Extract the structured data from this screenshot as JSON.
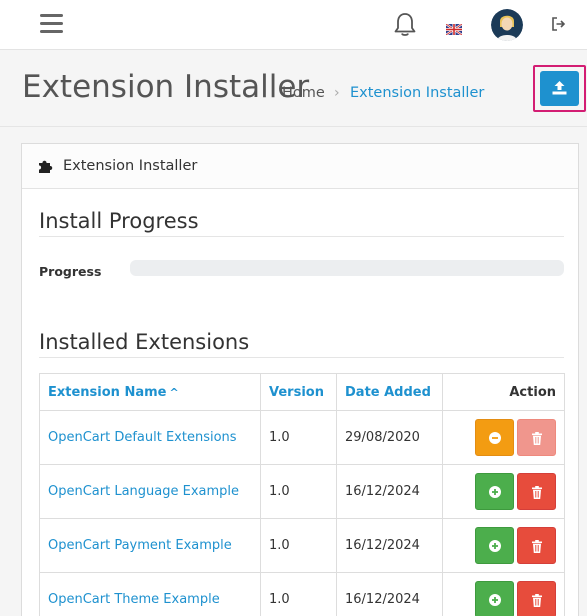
{
  "header": {
    "menu_icon": "hamburger-menu-icon",
    "notification_icon": "bell-icon",
    "language_icon": "uk-flag-icon",
    "user_icon": "user-avatar",
    "logout_icon": "sign-out-icon"
  },
  "page": {
    "title": "Extension Installer",
    "breadcrumb": [
      {
        "label": "Home"
      },
      {
        "label": "Extension Installer"
      }
    ],
    "breadcrumb_separator": "›",
    "upload_icon": "upload-icon"
  },
  "panel": {
    "heading": "Extension Installer",
    "heading_icon": "puzzle-piece-icon"
  },
  "install_progress": {
    "title": "Install Progress",
    "label": "Progress",
    "value_percent": 0
  },
  "installed": {
    "title": "Installed Extensions",
    "columns": {
      "name": "Extension Name",
      "sort_indicator": "^",
      "version": "Version",
      "date_added": "Date Added",
      "action": "Action"
    },
    "rows": [
      {
        "name": "OpenCart Default Extensions",
        "version": "1.0",
        "date_added": "29/08/2020",
        "status": "installed"
      },
      {
        "name": "OpenCart Language Example",
        "version": "1.0",
        "date_added": "16/12/2024",
        "status": "not_installed"
      },
      {
        "name": "OpenCart Payment Example",
        "version": "1.0",
        "date_added": "16/12/2024",
        "status": "not_installed"
      },
      {
        "name": "OpenCart Theme Example",
        "version": "1.0",
        "date_added": "16/12/2024",
        "status": "not_installed"
      }
    ]
  },
  "colors": {
    "primary": "#1e91cf",
    "warning": "#f39c12",
    "success": "#4cae4c",
    "danger": "#e74c3c",
    "highlight": "#d31d73"
  }
}
